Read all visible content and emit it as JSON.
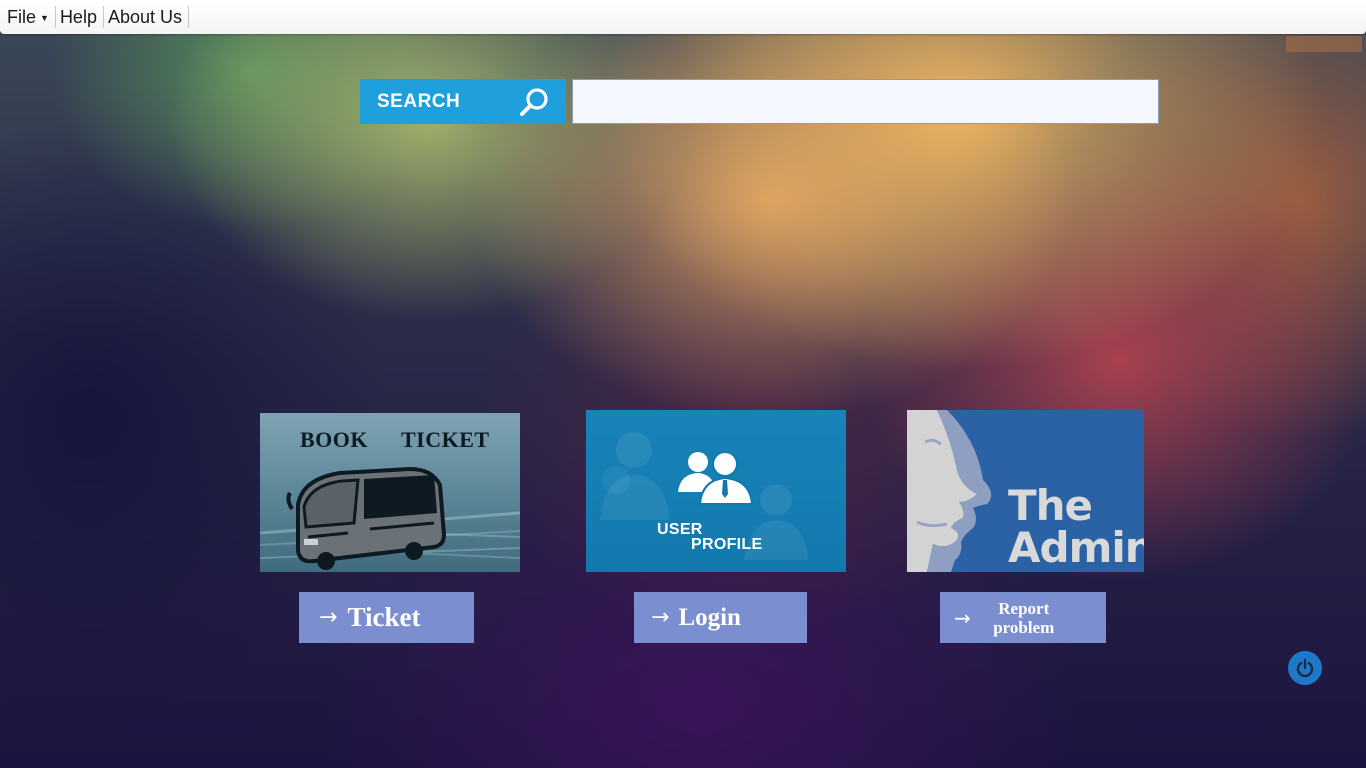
{
  "menubar": {
    "items": [
      {
        "label": "File"
      },
      {
        "label": "Help"
      },
      {
        "label": "About Us"
      }
    ]
  },
  "search": {
    "button_label": "SEARCH",
    "value": "",
    "placeholder": ""
  },
  "tiles": {
    "book": {
      "word1": "BOOK",
      "word2": "TICKET"
    },
    "user": {
      "line1": "USER",
      "line2": "PROFILE"
    },
    "admin": {
      "line1": "The",
      "line2": "Admin"
    }
  },
  "actions": {
    "ticket": "Ticket",
    "login": "Login",
    "report": "Report problem"
  },
  "colors": {
    "accent_search": "#1f9fdc",
    "action_button": "#7b8ed0",
    "power_button": "#1e78c8"
  },
  "icons": [
    "caret-down-icon",
    "search-icon",
    "bus-icon",
    "users-icon",
    "face-silhouette-icon",
    "arrow-right-icon",
    "power-icon"
  ]
}
